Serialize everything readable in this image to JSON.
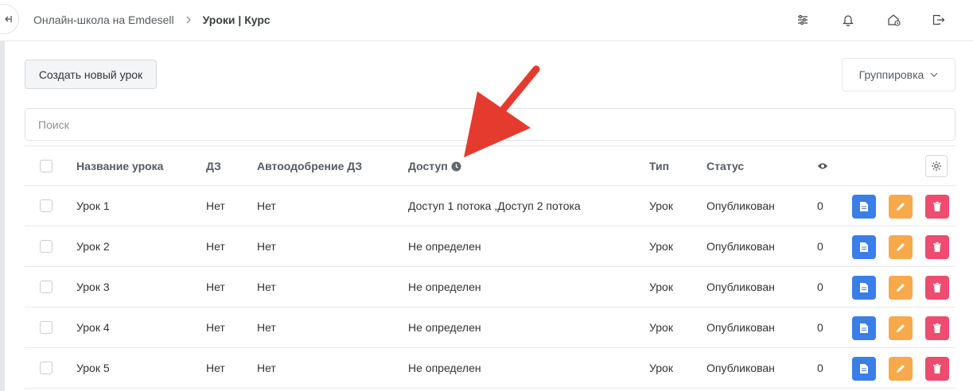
{
  "header": {
    "breadcrumb_root": "Онлайн-школа на Emdesell",
    "breadcrumb_current": "Уроки | Курс"
  },
  "toolbar": {
    "create_label": "Создать новый урок",
    "group_label": "Группировка"
  },
  "search": {
    "placeholder": "Поиск",
    "value": ""
  },
  "table": {
    "columns": {
      "name": "Название урока",
      "homework": "ДЗ",
      "auto_approve": "Автоодобрение ДЗ",
      "access": "Доступ",
      "type": "Тип",
      "status": "Статус"
    },
    "rows": [
      {
        "name": "Урок 1",
        "homework": "Нет",
        "auto_approve": "Нет",
        "access": "Доступ 1 потока ,Доступ 2 потока",
        "type": "Урок",
        "status": "Опубликован",
        "views": "0"
      },
      {
        "name": "Урок 2",
        "homework": "Нет",
        "auto_approve": "Нет",
        "access": "Не определен",
        "type": "Урок",
        "status": "Опубликован",
        "views": "0"
      },
      {
        "name": "Урок 3",
        "homework": "Нет",
        "auto_approve": "Нет",
        "access": "Не определен",
        "type": "Урок",
        "status": "Опубликован",
        "views": "0"
      },
      {
        "name": "Урок 4",
        "homework": "Нет",
        "auto_approve": "Нет",
        "access": "Не определен",
        "type": "Урок",
        "status": "Опубликован",
        "views": "0"
      },
      {
        "name": "Урок 5",
        "homework": "Нет",
        "auto_approve": "Нет",
        "access": "Не определен",
        "type": "Урок",
        "status": "Опубликован",
        "views": "0"
      }
    ]
  },
  "icons": {
    "collapse": "collapse-sidebar-icon",
    "filters": "sliders-icon",
    "notifications": "bell-icon",
    "home": "home-icon",
    "logout": "logout-icon",
    "views": "eye-icon",
    "access_info": "clock-icon",
    "settings": "gear-icon",
    "row_doc": "document-icon",
    "row_edit": "pencil-icon",
    "row_delete": "trash-icon"
  },
  "colors": {
    "doc_button": "#3a7ee8",
    "edit_button": "#f8a94a",
    "delete_button": "#ec4c6e",
    "annotation_arrow": "#e53b2f"
  }
}
